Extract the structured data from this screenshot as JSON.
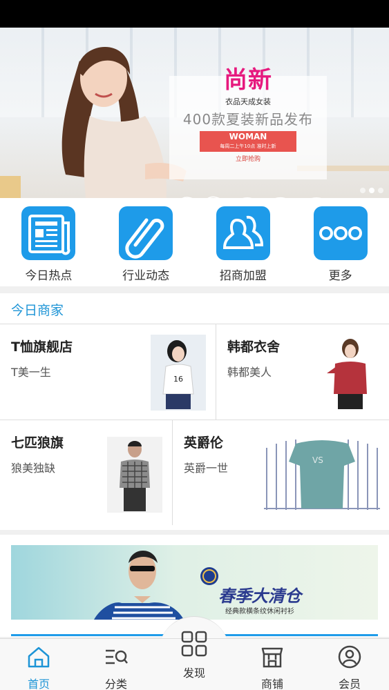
{
  "banner": {
    "logo_text": "尚新",
    "subtitle": "衣品天成女装",
    "headline": "400款夏装新品发布",
    "badge": "WOMAN",
    "badge_sub": "每周二上午10点 准时上新",
    "cta": "立即抢购",
    "slides_total": 3,
    "active_slide": 2
  },
  "quick_nav": [
    {
      "label": "今日热点",
      "icon": "newspaper-icon"
    },
    {
      "label": "行业动态",
      "icon": "paperclip-icon"
    },
    {
      "label": "招商加盟",
      "icon": "users-icon"
    },
    {
      "label": "更多",
      "icon": "more-dots-icon"
    }
  ],
  "merchants": {
    "title": "今日商家",
    "items": [
      {
        "name": "T恤旗舰店",
        "slogan": "T美一生"
      },
      {
        "name": "韩都衣舍",
        "slogan": "韩都美人"
      },
      {
        "name": "七匹狼旗",
        "slogan": "狼美独缺"
      },
      {
        "name": "英爵伦",
        "slogan": "英爵一世"
      }
    ]
  },
  "ad": {
    "title": "春季大清仓",
    "subtitle": "经典款横条纹休闲衬衫"
  },
  "tab_bar": [
    {
      "label": "首页",
      "icon": "home-icon",
      "active": true
    },
    {
      "label": "分类",
      "icon": "category-search-icon",
      "active": false
    },
    {
      "label": "发现",
      "icon": "grid-icon",
      "active": false
    },
    {
      "label": "商铺",
      "icon": "shop-icon",
      "active": false
    },
    {
      "label": "会员",
      "icon": "user-icon",
      "active": false
    }
  ],
  "colors": {
    "accent": "#1e9be9",
    "section_title": "#1d94d6",
    "promo_pink": "#e6197e",
    "promo_red": "#e8544f"
  }
}
